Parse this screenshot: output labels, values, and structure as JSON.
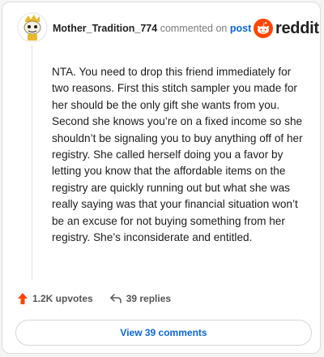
{
  "header": {
    "username": "Mother_Tradition_774",
    "action": "commented on",
    "post_link": "post",
    "brand": "reddit"
  },
  "comment": {
    "text": "NTA. You need to drop this friend immediately for two reasons. First this stitch sampler you made for her should be the only gift she wants from you. Second she knows you’re on a fixed income so she shouldn’t be signaling you to buy anything off of her registry. She called herself doing you a favor by letting you know that the affordable items on the registry are quickly running out but what she was really saying was that your financial situation won’t be an excuse for not buying something from her registry. She’s inconsiderate and entitled."
  },
  "footer": {
    "upvotes": "1.2K upvotes",
    "replies": "39 replies",
    "view_comments": "View 39 comments"
  },
  "colors": {
    "reddit_orange": "#ff4500",
    "link_blue": "#0a66d8",
    "upvote_orange": "#ff4500"
  },
  "icons": [
    "avatar-snoo-icon",
    "reddit-logo-icon",
    "upvote-arrow-icon",
    "reply-arrow-icon"
  ]
}
